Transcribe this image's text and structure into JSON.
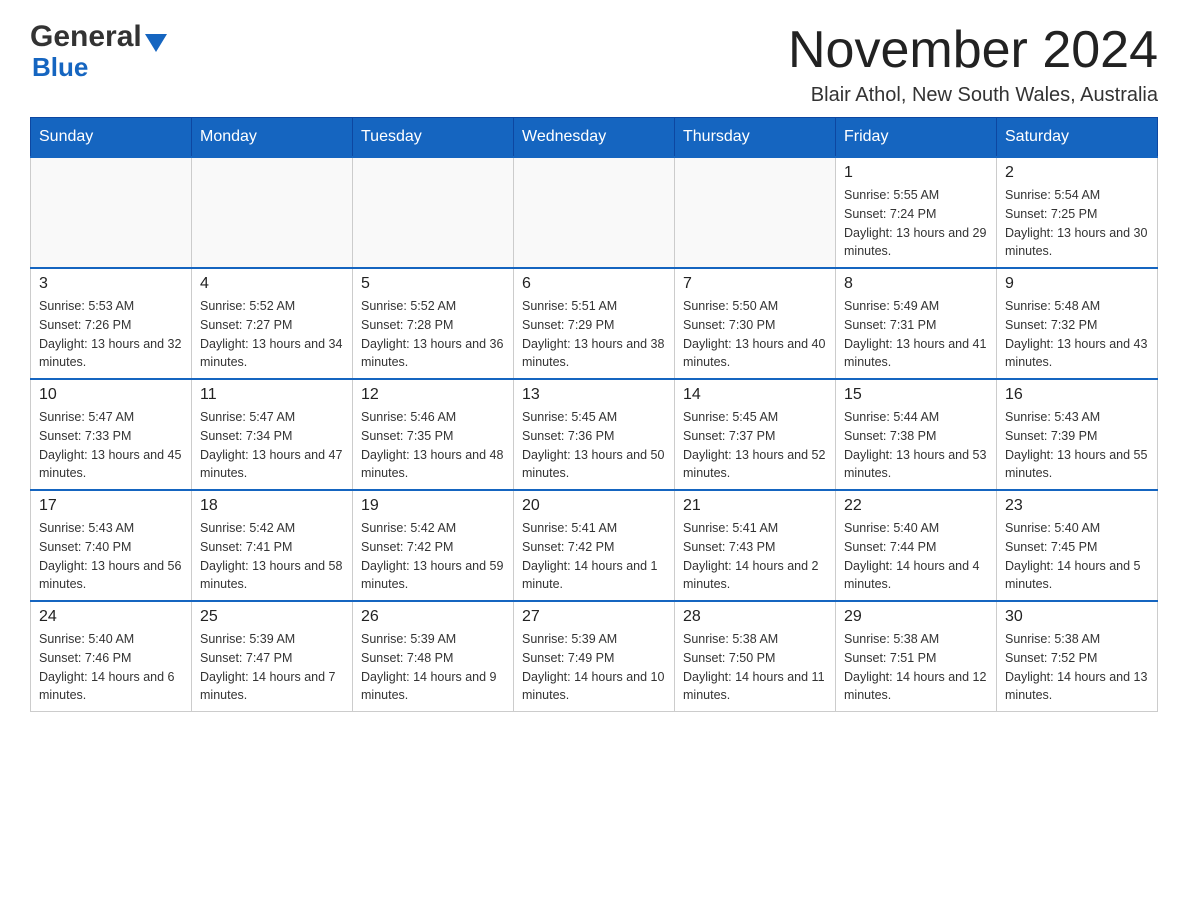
{
  "header": {
    "logo_general": "General",
    "logo_blue": "Blue",
    "title": "November 2024",
    "subtitle": "Blair Athol, New South Wales, Australia"
  },
  "weekdays": [
    "Sunday",
    "Monday",
    "Tuesday",
    "Wednesday",
    "Thursday",
    "Friday",
    "Saturday"
  ],
  "weeks": [
    [
      {
        "day": "",
        "sunrise": "",
        "sunset": "",
        "daylight": ""
      },
      {
        "day": "",
        "sunrise": "",
        "sunset": "",
        "daylight": ""
      },
      {
        "day": "",
        "sunrise": "",
        "sunset": "",
        "daylight": ""
      },
      {
        "day": "",
        "sunrise": "",
        "sunset": "",
        "daylight": ""
      },
      {
        "day": "",
        "sunrise": "",
        "sunset": "",
        "daylight": ""
      },
      {
        "day": "1",
        "sunrise": "Sunrise: 5:55 AM",
        "sunset": "Sunset: 7:24 PM",
        "daylight": "Daylight: 13 hours and 29 minutes."
      },
      {
        "day": "2",
        "sunrise": "Sunrise: 5:54 AM",
        "sunset": "Sunset: 7:25 PM",
        "daylight": "Daylight: 13 hours and 30 minutes."
      }
    ],
    [
      {
        "day": "3",
        "sunrise": "Sunrise: 5:53 AM",
        "sunset": "Sunset: 7:26 PM",
        "daylight": "Daylight: 13 hours and 32 minutes."
      },
      {
        "day": "4",
        "sunrise": "Sunrise: 5:52 AM",
        "sunset": "Sunset: 7:27 PM",
        "daylight": "Daylight: 13 hours and 34 minutes."
      },
      {
        "day": "5",
        "sunrise": "Sunrise: 5:52 AM",
        "sunset": "Sunset: 7:28 PM",
        "daylight": "Daylight: 13 hours and 36 minutes."
      },
      {
        "day": "6",
        "sunrise": "Sunrise: 5:51 AM",
        "sunset": "Sunset: 7:29 PM",
        "daylight": "Daylight: 13 hours and 38 minutes."
      },
      {
        "day": "7",
        "sunrise": "Sunrise: 5:50 AM",
        "sunset": "Sunset: 7:30 PM",
        "daylight": "Daylight: 13 hours and 40 minutes."
      },
      {
        "day": "8",
        "sunrise": "Sunrise: 5:49 AM",
        "sunset": "Sunset: 7:31 PM",
        "daylight": "Daylight: 13 hours and 41 minutes."
      },
      {
        "day": "9",
        "sunrise": "Sunrise: 5:48 AM",
        "sunset": "Sunset: 7:32 PM",
        "daylight": "Daylight: 13 hours and 43 minutes."
      }
    ],
    [
      {
        "day": "10",
        "sunrise": "Sunrise: 5:47 AM",
        "sunset": "Sunset: 7:33 PM",
        "daylight": "Daylight: 13 hours and 45 minutes."
      },
      {
        "day": "11",
        "sunrise": "Sunrise: 5:47 AM",
        "sunset": "Sunset: 7:34 PM",
        "daylight": "Daylight: 13 hours and 47 minutes."
      },
      {
        "day": "12",
        "sunrise": "Sunrise: 5:46 AM",
        "sunset": "Sunset: 7:35 PM",
        "daylight": "Daylight: 13 hours and 48 minutes."
      },
      {
        "day": "13",
        "sunrise": "Sunrise: 5:45 AM",
        "sunset": "Sunset: 7:36 PM",
        "daylight": "Daylight: 13 hours and 50 minutes."
      },
      {
        "day": "14",
        "sunrise": "Sunrise: 5:45 AM",
        "sunset": "Sunset: 7:37 PM",
        "daylight": "Daylight: 13 hours and 52 minutes."
      },
      {
        "day": "15",
        "sunrise": "Sunrise: 5:44 AM",
        "sunset": "Sunset: 7:38 PM",
        "daylight": "Daylight: 13 hours and 53 minutes."
      },
      {
        "day": "16",
        "sunrise": "Sunrise: 5:43 AM",
        "sunset": "Sunset: 7:39 PM",
        "daylight": "Daylight: 13 hours and 55 minutes."
      }
    ],
    [
      {
        "day": "17",
        "sunrise": "Sunrise: 5:43 AM",
        "sunset": "Sunset: 7:40 PM",
        "daylight": "Daylight: 13 hours and 56 minutes."
      },
      {
        "day": "18",
        "sunrise": "Sunrise: 5:42 AM",
        "sunset": "Sunset: 7:41 PM",
        "daylight": "Daylight: 13 hours and 58 minutes."
      },
      {
        "day": "19",
        "sunrise": "Sunrise: 5:42 AM",
        "sunset": "Sunset: 7:42 PM",
        "daylight": "Daylight: 13 hours and 59 minutes."
      },
      {
        "day": "20",
        "sunrise": "Sunrise: 5:41 AM",
        "sunset": "Sunset: 7:42 PM",
        "daylight": "Daylight: 14 hours and 1 minute."
      },
      {
        "day": "21",
        "sunrise": "Sunrise: 5:41 AM",
        "sunset": "Sunset: 7:43 PM",
        "daylight": "Daylight: 14 hours and 2 minutes."
      },
      {
        "day": "22",
        "sunrise": "Sunrise: 5:40 AM",
        "sunset": "Sunset: 7:44 PM",
        "daylight": "Daylight: 14 hours and 4 minutes."
      },
      {
        "day": "23",
        "sunrise": "Sunrise: 5:40 AM",
        "sunset": "Sunset: 7:45 PM",
        "daylight": "Daylight: 14 hours and 5 minutes."
      }
    ],
    [
      {
        "day": "24",
        "sunrise": "Sunrise: 5:40 AM",
        "sunset": "Sunset: 7:46 PM",
        "daylight": "Daylight: 14 hours and 6 minutes."
      },
      {
        "day": "25",
        "sunrise": "Sunrise: 5:39 AM",
        "sunset": "Sunset: 7:47 PM",
        "daylight": "Daylight: 14 hours and 7 minutes."
      },
      {
        "day": "26",
        "sunrise": "Sunrise: 5:39 AM",
        "sunset": "Sunset: 7:48 PM",
        "daylight": "Daylight: 14 hours and 9 minutes."
      },
      {
        "day": "27",
        "sunrise": "Sunrise: 5:39 AM",
        "sunset": "Sunset: 7:49 PM",
        "daylight": "Daylight: 14 hours and 10 minutes."
      },
      {
        "day": "28",
        "sunrise": "Sunrise: 5:38 AM",
        "sunset": "Sunset: 7:50 PM",
        "daylight": "Daylight: 14 hours and 11 minutes."
      },
      {
        "day": "29",
        "sunrise": "Sunrise: 5:38 AM",
        "sunset": "Sunset: 7:51 PM",
        "daylight": "Daylight: 14 hours and 12 minutes."
      },
      {
        "day": "30",
        "sunrise": "Sunrise: 5:38 AM",
        "sunset": "Sunset: 7:52 PM",
        "daylight": "Daylight: 14 hours and 13 minutes."
      }
    ]
  ]
}
